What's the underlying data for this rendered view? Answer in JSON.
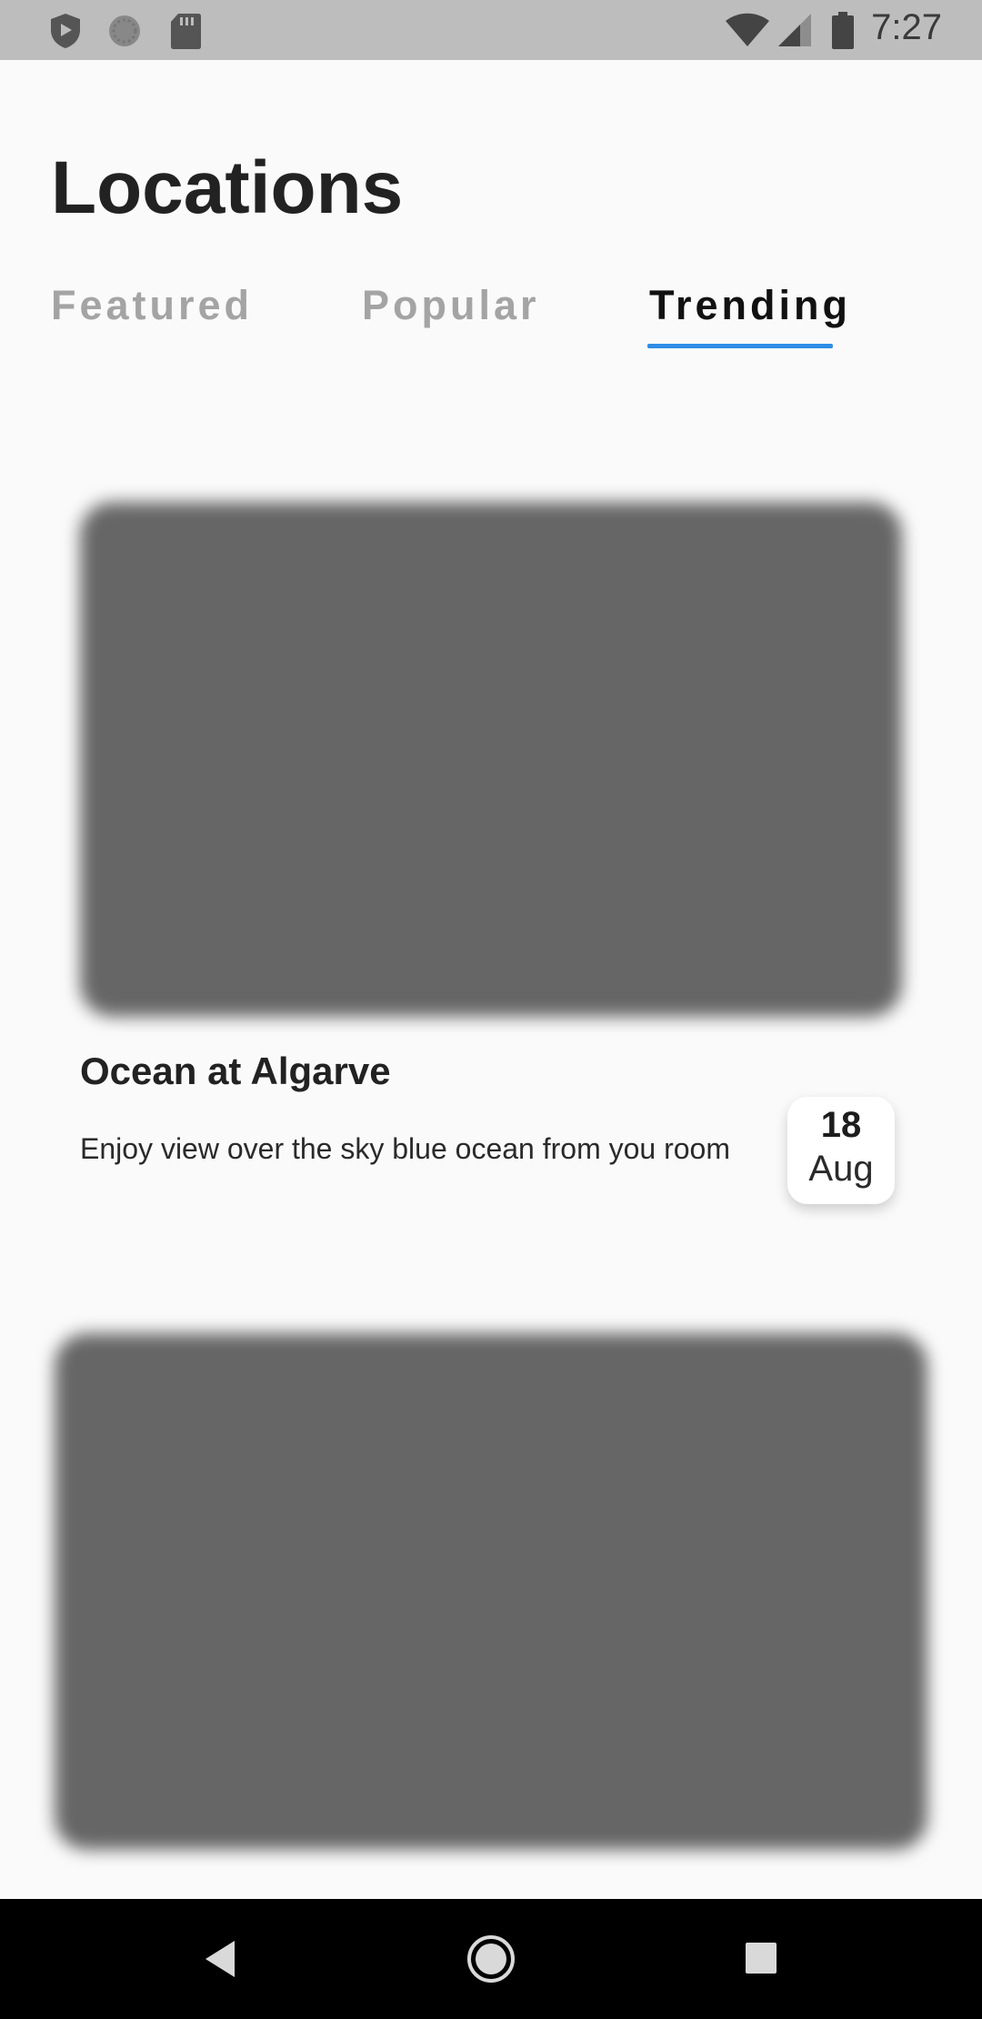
{
  "status_bar": {
    "time": "7:27",
    "left_icons": [
      "shield-icon",
      "sync-icon",
      "sd-card-icon"
    ],
    "right_icons": [
      "wifi-icon",
      "cell-signal-icon",
      "battery-icon"
    ]
  },
  "header": {
    "title": "Locations"
  },
  "tabs": [
    {
      "label": "Featured",
      "active": false
    },
    {
      "label": "Popular",
      "active": false
    },
    {
      "label": "Trending",
      "active": true
    }
  ],
  "accent_color": "#2e8de6",
  "cards": [
    {
      "title": "Ocean at Algarve",
      "description": "Enjoy view over the sky blue ocean from you room",
      "date": {
        "day": "18",
        "month": "Aug"
      }
    },
    {
      "title": "",
      "description": ""
    }
  ],
  "nav_bar": {
    "buttons": [
      "back-icon",
      "home-icon",
      "recents-icon"
    ]
  }
}
